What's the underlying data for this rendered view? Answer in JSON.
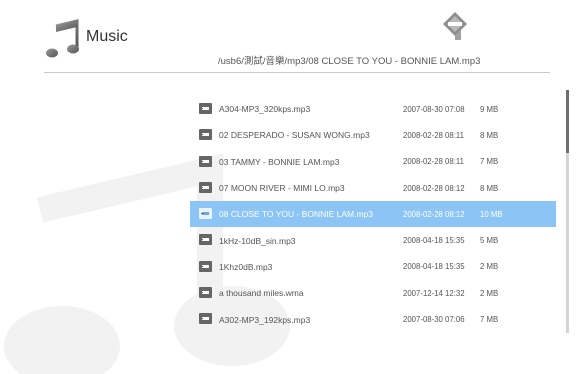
{
  "header": {
    "title": "Music",
    "app_icon": "music-note-icon",
    "brand_logo": "diamond-logo-icon",
    "breadcrumb": "/usb6/測試/音樂/mp3/08 CLOSE TO YOU - BONNIE LAM.mp3"
  },
  "colors": {
    "selection": "#8cc5f5",
    "text": "#555555",
    "rule": "#c8c8c8"
  },
  "files": [
    {
      "name": "A304-MP3_320kps.mp3",
      "date": "2007-08-30 07:08",
      "size": "9 MB"
    },
    {
      "name": "02 DESPERADO - SUSAN WONG.mp3",
      "date": "2008-02-28 08:11",
      "size": "8 MB"
    },
    {
      "name": "03 TAMMY - BONNIE LAM.mp3",
      "date": "2008-02-28 08:11",
      "size": "7 MB"
    },
    {
      "name": "07 MOON RIVER - MIMI LO.mp3",
      "date": "2008-02-28 08:12",
      "size": "8 MB"
    },
    {
      "name": "08 CLOSE TO YOU - BONNIE LAM.mp3",
      "date": "2008-02-28 08:12",
      "size": "10 MB",
      "selected": true
    },
    {
      "name": "1kHz-10dB_sin.mp3",
      "date": "2008-04-18 15:35",
      "size": "5 MB"
    },
    {
      "name": "1Khz0dB.mp3",
      "date": "2008-04-18 15:35",
      "size": "2 MB"
    },
    {
      "name": "a thousand miles.wma",
      "date": "2007-12-14 12:32",
      "size": "2 MB"
    },
    {
      "name": "A302-MP3_192kps.mp3",
      "date": "2007-08-30 07:06",
      "size": "7 MB"
    }
  ],
  "scrollbar": {
    "position_fraction": 0.0,
    "visible_fraction": 0.26
  }
}
